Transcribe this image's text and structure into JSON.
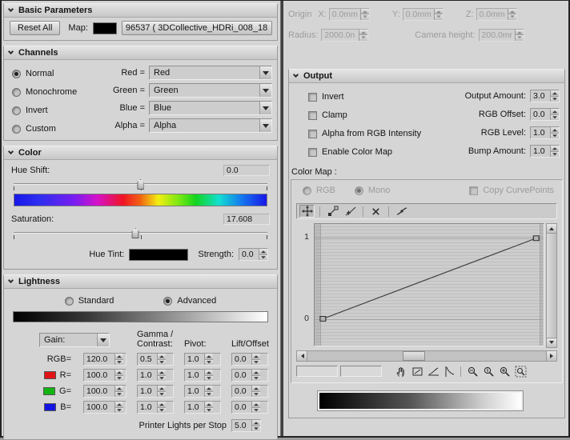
{
  "left": {
    "basic": {
      "title": "Basic Parameters",
      "reset_button": "Reset All",
      "map_label": "Map:",
      "map_button": "96537 ( 3DCollective_HDRi_008_18"
    },
    "channels": {
      "title": "Channels",
      "options": [
        "Normal",
        "Monochrome",
        "Invert",
        "Custom"
      ],
      "selected_option": "Normal",
      "rows": [
        {
          "label": "Red =",
          "value": "Red"
        },
        {
          "label": "Green =",
          "value": "Green"
        },
        {
          "label": "Blue =",
          "value": "Blue"
        },
        {
          "label": "Alpha =",
          "value": "Alpha"
        }
      ]
    },
    "color": {
      "title": "Color",
      "hue_shift": {
        "label": "Hue Shift:",
        "value": "0.0"
      },
      "saturation": {
        "label": "Saturation:",
        "value": "17.608"
      },
      "hue_tint": {
        "label": "Hue Tint:"
      },
      "strength": {
        "label": "Strength:",
        "value": "0.0"
      }
    },
    "lightness": {
      "title": "Lightness",
      "modes": [
        "Standard",
        "Advanced"
      ],
      "selected_mode": "Advanced",
      "gain_label": "Gain:",
      "headers": {
        "gamma1": "Gamma /",
        "gamma2": "Contrast:",
        "pivot": "Pivot:",
        "lift": "Lift/Offset"
      },
      "rows": [
        {
          "label": "RGB=",
          "v1": "120.0",
          "v2": "0.5",
          "v3": "1.0",
          "v4": "0.0"
        },
        {
          "label": "R=",
          "v1": "100.0",
          "v2": "1.0",
          "v3": "1.0",
          "v4": "0.0"
        },
        {
          "label": "G=",
          "v1": "100.0",
          "v2": "1.0",
          "v3": "1.0",
          "v4": "0.0"
        },
        {
          "label": "B=",
          "v1": "100.0",
          "v2": "1.0",
          "v3": "1.0",
          "v4": "0.0"
        }
      ],
      "printer": {
        "label": "Printer Lights per Stop",
        "value": "5.0"
      }
    }
  },
  "right": {
    "placement": {
      "origin_label": "Origin",
      "x_label": "X:",
      "x_value": "0.0mm",
      "y_label": "Y:",
      "y_value": "0.0mm",
      "z_label": "Z:",
      "z_value": "0.0mm",
      "radius_label": "Radius:",
      "radius_value": "2000.0n",
      "camera_label": "Camera height:",
      "camera_value": "200.0mr"
    },
    "output": {
      "title": "Output",
      "checkboxes": [
        "Invert",
        "Clamp",
        "Alpha from RGB Intensity",
        "Enable Color Map"
      ],
      "amounts": [
        {
          "label": "Output Amount:",
          "value": "3.0"
        },
        {
          "label": "RGB Offset:",
          "value": "0.0"
        },
        {
          "label": "RGB Level:",
          "value": "1.0"
        },
        {
          "label": "Bump Amount:",
          "value": "1.0"
        }
      ],
      "color_map": {
        "label": "Color Map :",
        "rgb": "RGB",
        "mono": "Mono",
        "selected": "Mono",
        "copy": "Copy CurvePoints",
        "y_max": "1",
        "y_min": "0",
        "curve_points": [
          {
            "x": 0,
            "y": 0
          },
          {
            "x": 1,
            "y": 1
          }
        ]
      }
    }
  },
  "icons": {
    "rollout_header": "chevron-down",
    "spinner": "up-down-arrows",
    "dropdown": "down-arrow",
    "curve_toolbar": [
      "move-point",
      "scale-point",
      "add-point",
      "delete-point",
      "smooth-curve"
    ],
    "curve_tools": [
      "pan-hand",
      "zoom-extents",
      "zoom-horizontal-extents",
      "zoom-value-extents",
      "zoom-horizontal",
      "zoom-value",
      "zoom",
      "zoom-region"
    ]
  },
  "colors": {
    "panel_bg": "#d5d5d5",
    "map_swatch": "#000000",
    "hue_tint_swatch": "#000000",
    "red_swatch": "#e01414",
    "green_swatch": "#12b412",
    "blue_swatch": "#1414e0",
    "curve_line": "#3c3c3c"
  }
}
